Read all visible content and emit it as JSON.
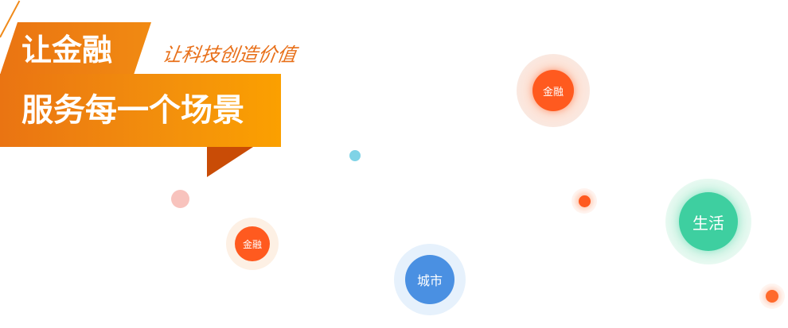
{
  "banner": {
    "title_line1": "让金融",
    "title_line2": "服务每一个场景",
    "slogan": "让科技创造价值"
  },
  "bubbles": {
    "finance_top": "金融",
    "finance_left": "金融",
    "city": "城市",
    "life": "生活"
  },
  "colors": {
    "brand_orange": "#f08a12",
    "banner_fold": "#c94c06",
    "bubble_orange": "#ff5a1f",
    "bubble_blue": "#4a90e2",
    "bubble_green": "#3ecfa0",
    "dot_cyan": "#7fd3e6",
    "dot_pink": "#f8c3bd"
  }
}
